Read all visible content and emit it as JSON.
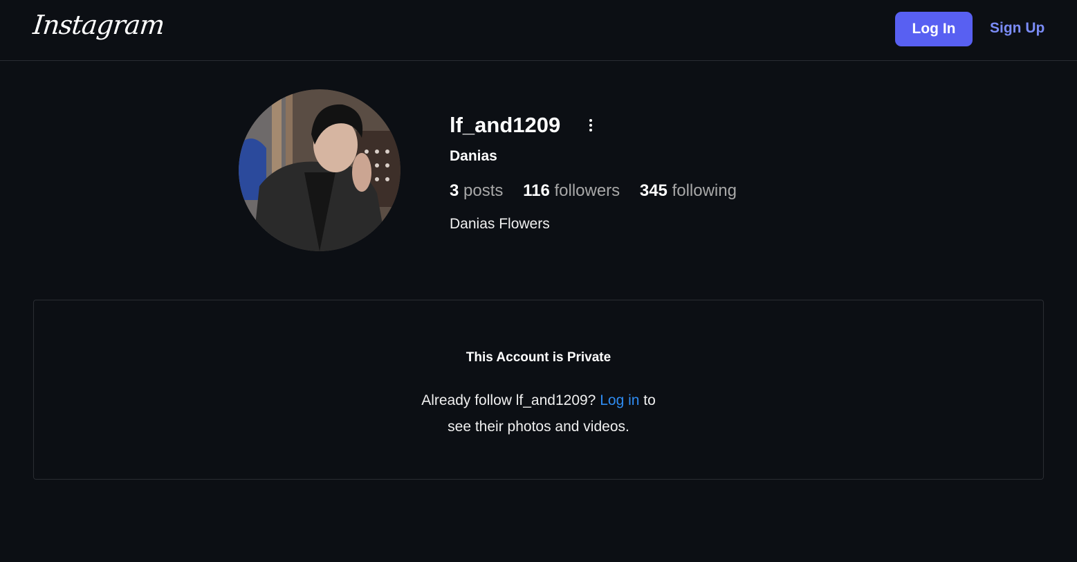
{
  "header": {
    "logo_text": "Instagram",
    "login_label": "Log In",
    "signup_label": "Sign Up"
  },
  "profile": {
    "username": "lf_and1209",
    "full_name": "Danias",
    "stats": {
      "posts_count": "3",
      "posts_label": "posts",
      "followers_count": "116",
      "followers_label": "followers",
      "following_count": "345",
      "following_label": "following"
    },
    "bio": "Danias Flowers"
  },
  "private_notice": {
    "title": "This Account is Private",
    "message_prefix": "Already follow lf_and1209?",
    "login_link": "Log in",
    "message_suffix_1": "to",
    "message_suffix_2": "see their photos and videos."
  },
  "colors": {
    "background": "#0c0f14",
    "primary_button": "#5860f2",
    "link": "#2f8cf2",
    "signup": "#7b8cf7"
  },
  "icons": {
    "more_options": "more-options-icon",
    "avatar": "avatar"
  }
}
